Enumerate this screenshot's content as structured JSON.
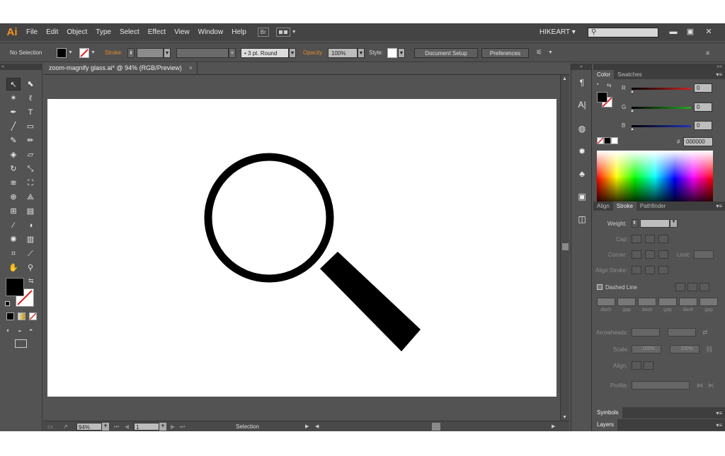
{
  "app": {
    "logo": "Ai"
  },
  "menu": [
    "File",
    "Edit",
    "Object",
    "Type",
    "Select",
    "Effect",
    "View",
    "Window",
    "Help"
  ],
  "menubar_icon": "Br",
  "workspace": "HIKEART",
  "window_controls": [
    "minimize-icon",
    "maximize-icon",
    "close-icon"
  ],
  "control_bar": {
    "selection_status": "No Selection",
    "stroke_label": "Stroke",
    "brush": "3 pt. Round",
    "opacity_label": "Opacity",
    "opacity_value": "100%",
    "style_label": "Style:",
    "document_setup": "Document Setup",
    "preferences": "Preferences"
  },
  "document": {
    "tab_title": "zoom-magnify glass.ai* @ 94% (RGB/Preview)",
    "close": "×"
  },
  "status_bar": {
    "zoom": "94%",
    "page": "1",
    "tool": "Selection"
  },
  "color_panel": {
    "tabs": [
      "Color",
      "Swatches"
    ],
    "channels": [
      {
        "label": "R",
        "value": "0",
        "color": "#cc2222"
      },
      {
        "label": "G",
        "value": "0",
        "color": "#22aa22"
      },
      {
        "label": "B",
        "value": "0",
        "color": "#2233bb"
      }
    ],
    "hex_label": "#",
    "hex": "000000"
  },
  "stroke_panel": {
    "tabs": [
      "Align",
      "Stroke",
      "Pathfinder"
    ],
    "weight_label": "Weight:",
    "cap_label": "Cap:",
    "corner_label": "Corner:",
    "limit_label": "Limit:",
    "align_stroke_label": "Align Stroke:",
    "dashed_line_label": "Dashed Line",
    "dash_labels": [
      "dash",
      "gap",
      "dash",
      "gap",
      "dash",
      "gap"
    ],
    "arrowheads_label": "Arrowheads:",
    "scale_label": "Scale:",
    "scale_values": [
      "100%",
      "100%"
    ],
    "align_label": "Align:",
    "profile_label": "Profile:"
  },
  "collapsed_panels": [
    "Symbols",
    "Layers"
  ],
  "colors": {
    "accent": "#f7931e",
    "ui_bg": "#535353",
    "menubar_bg": "#444444",
    "artboard": "#ffffff",
    "fill": "#000000"
  }
}
